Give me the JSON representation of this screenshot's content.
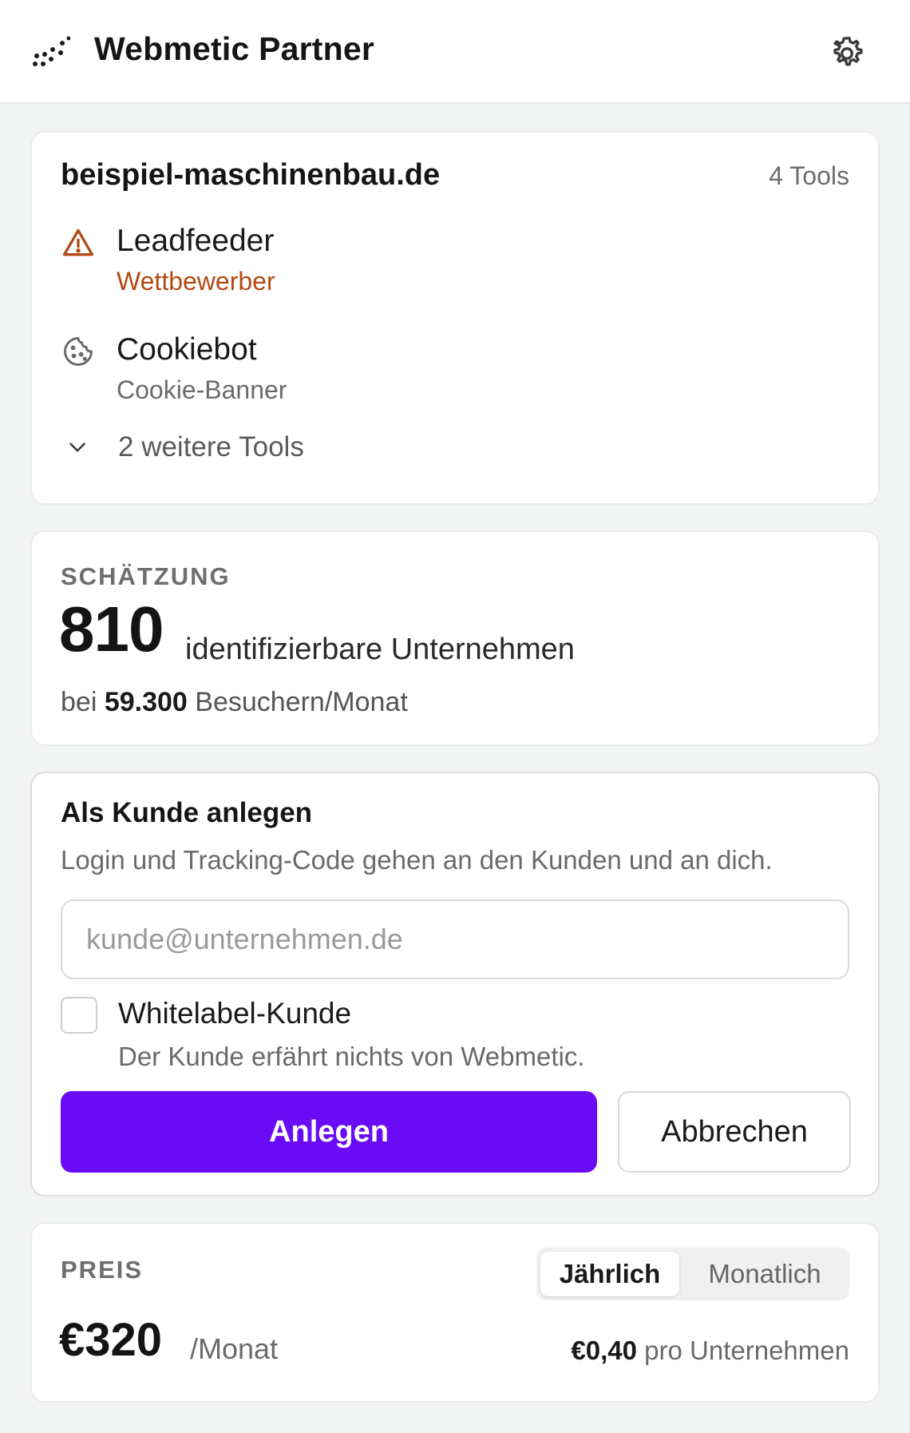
{
  "header": {
    "app_title": "Webmetic Partner",
    "logo_icon": "dot-grid-logo",
    "settings_icon": "gear-icon"
  },
  "site_card": {
    "domain": "beispiel-maschinenbau.de",
    "tool_count": "4 Tools",
    "tools": [
      {
        "name": "Leadfeeder",
        "category": "Wettbewerber",
        "icon": "warning-triangle-icon",
        "color": "#b24a14"
      },
      {
        "name": "Cookiebot",
        "category": "Cookie-Banner",
        "icon": "cookie-icon",
        "color": "#6b6b6b"
      }
    ],
    "more_tools": "2 weitere Tools"
  },
  "estimate": {
    "kicker": "SCHÄTZUNG",
    "companies": "810",
    "companies_label": "identifizierbare Unternehmen",
    "visits_prefix": "bei",
    "visits_value": "59.300",
    "visits_suffix": "Besuchern/Monat"
  },
  "create_customer": {
    "title": "Als Kunde anlegen",
    "description": "Login und Tracking-Code gehen an den Kunden und an dich.",
    "email_placeholder": "kunde@unternehmen.de",
    "email_value": "",
    "whitelabel_label": "Whitelabel-Kunde",
    "whitelabel_description": "Der Kunde erfährt nichts von Webmetic.",
    "whitelabel_checked": false,
    "primary_button": "Anlegen",
    "secondary_button": "Abbrechen",
    "accent_color": "#6a0bf6"
  },
  "price": {
    "kicker": "PREIS",
    "billing_options": [
      "Jährlich",
      "Monatlich"
    ],
    "selected_billing": "Jährlich",
    "amount": "€320",
    "unit": "/Monat",
    "per_company_value": "€0,40",
    "per_company_label": "pro Unternehmen"
  }
}
